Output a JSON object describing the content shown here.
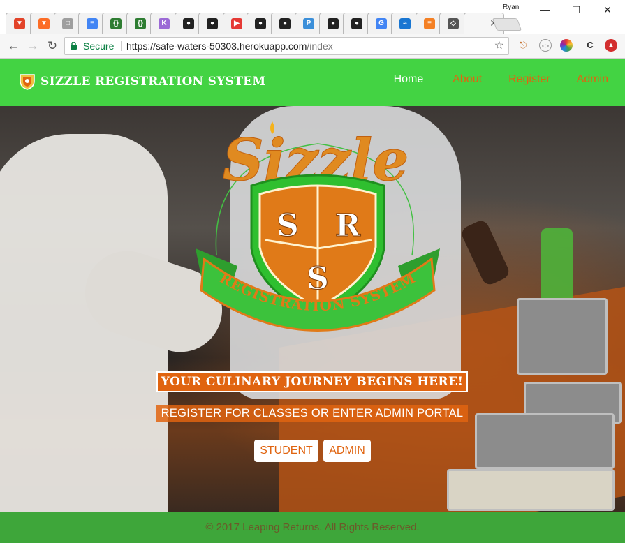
{
  "browser": {
    "profile_name": "Ryan",
    "tabs": [
      {
        "icon": "gitlab-icon",
        "color": "#e24329"
      },
      {
        "icon": "gitlab-icon",
        "color": "#fc6d26"
      },
      {
        "icon": "document-icon",
        "color": "#9e9e9e"
      },
      {
        "icon": "google-docs-icon",
        "color": "#4285f4"
      },
      {
        "icon": "code-icon",
        "color": "#2e7d32"
      },
      {
        "icon": "code-icon",
        "color": "#2e7d32"
      },
      {
        "icon": "k-icon",
        "color": "#9c6ad6"
      },
      {
        "icon": "github-icon",
        "color": "#222222"
      },
      {
        "icon": "github-icon",
        "color": "#222222"
      },
      {
        "icon": "youtube-icon",
        "color": "#e53935"
      },
      {
        "icon": "github-icon",
        "color": "#222222"
      },
      {
        "icon": "github-icon",
        "color": "#222222"
      },
      {
        "icon": "p-icon",
        "color": "#3b8fd9"
      },
      {
        "icon": "github-icon",
        "color": "#222222"
      },
      {
        "icon": "github-icon",
        "color": "#222222"
      },
      {
        "icon": "google-icon",
        "color": "#4285f4"
      },
      {
        "icon": "wave-icon",
        "color": "#1976d2"
      },
      {
        "icon": "stack-overflow-icon",
        "color": "#f48024"
      },
      {
        "icon": "codepen-icon",
        "color": "#555555"
      }
    ],
    "tab_letters": {
      "k": "K",
      "p": "P",
      "g": "G"
    },
    "address": {
      "secure_label": "Secure",
      "url_host": "https://safe-waters-50303.herokuapp.com",
      "url_path": "/index"
    }
  },
  "site": {
    "brand": "SIZZLE REGISTRATION SYSTEM",
    "nav": [
      {
        "label": "Home",
        "active": true
      },
      {
        "label": "About",
        "active": false
      },
      {
        "label": "Register",
        "active": false
      },
      {
        "label": "Admin",
        "active": false
      }
    ],
    "logo": {
      "wordmark": "Sizzle",
      "shield_letters": [
        "S",
        "R",
        "S"
      ],
      "ribbon_text": "REGISTRATION SYSTEM"
    },
    "hero": {
      "tagline": "YOUR CULINARY JOURNEY BEGINS HERE!",
      "subline": "REGISTER FOR CLASSES OR ENTER ADMIN PORTAL",
      "student_button": "STUDENT",
      "admin_button": "ADMIN"
    },
    "footer": "© 2017 Leaping Returns. All Rights Reserved.",
    "colors": {
      "nav_green": "#43d343",
      "footer_green": "#3ea63a",
      "accent_orange": "#e06410"
    }
  }
}
